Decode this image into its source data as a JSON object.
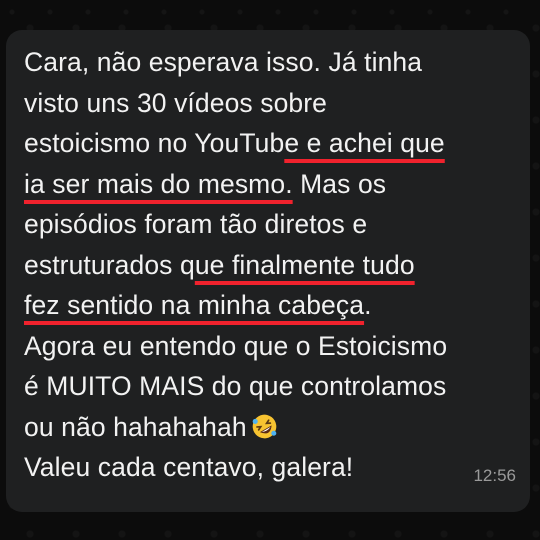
{
  "message": {
    "lines": [
      "Cara, não esperava isso. Já tinha",
      "visto uns 30 vídeos sobre",
      "estoicismo no YouTub",
      "e e achei que",
      "ia ser mais do mesmo.",
      " Mas os",
      "episódios foram tão diretos e",
      "estruturados q",
      "ue finalmente tudo",
      "fez sentido na minha cabeça",
      ".",
      "Agora eu entendo que o Estoicismo",
      "é MUITO MAIS do que controlamos",
      "ou não hahahahah",
      "Valeu cada centavo, galera!"
    ],
    "emoji": "rolling-on-floor-laughing-emoji",
    "timestamp": "12:56"
  },
  "colors": {
    "bubble": "#1f2021",
    "text": "#f2f2f2",
    "underline": "#f0222d",
    "timestamp": "#9a9a9a"
  }
}
